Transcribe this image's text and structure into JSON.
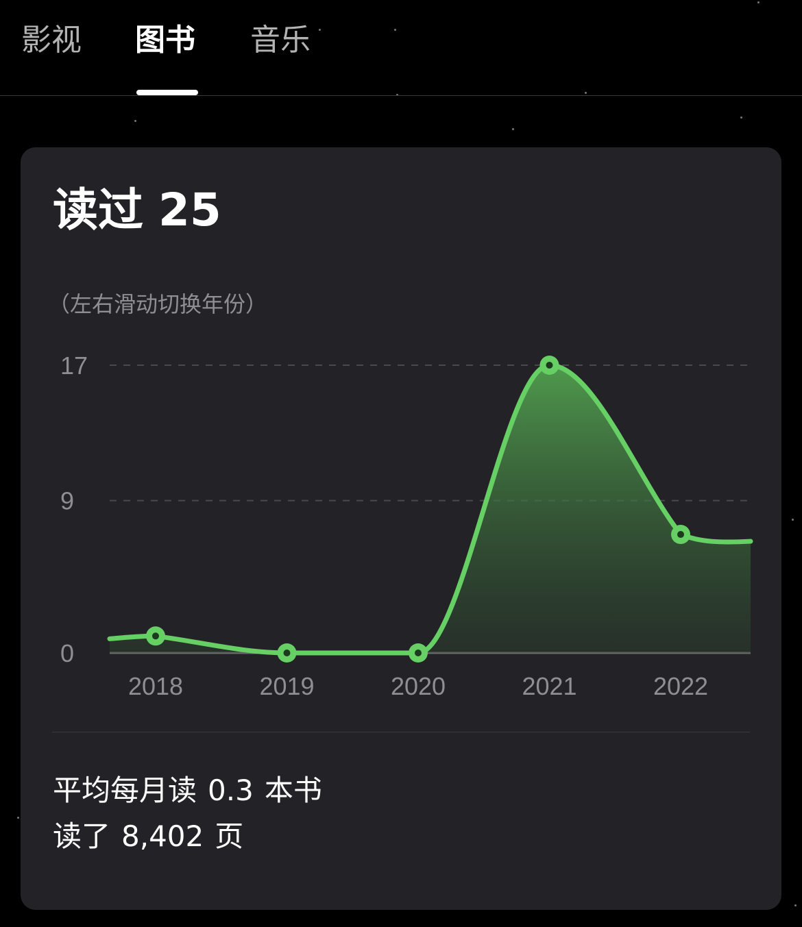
{
  "tabs": [
    {
      "label": "影视",
      "active": false
    },
    {
      "label": "图书",
      "active": true
    },
    {
      "label": "音乐",
      "active": false
    }
  ],
  "card": {
    "title_prefix": "读过",
    "title_count": "25",
    "hint": "（左右滑动切换年份）",
    "stat_avg_prefix": "平均每月读",
    "stat_avg_value": "0.3",
    "stat_avg_suffix": "本书",
    "stat_pages_prefix": "读了",
    "stat_pages_value": "8,402",
    "stat_pages_suffix": "页"
  },
  "colors": {
    "background": "#000000",
    "card": "#232327",
    "accent_green": "#66d064",
    "muted_text": "#8e8e93"
  },
  "chart_data": {
    "type": "area",
    "categories": [
      "2018",
      "2019",
      "2020",
      "2021",
      "2022"
    ],
    "values": [
      1,
      0,
      0,
      17,
      7
    ],
    "y_ticks": [
      "0",
      "9",
      "17"
    ],
    "ylim": [
      0,
      17
    ],
    "grid": true,
    "title": "",
    "xlabel": "",
    "ylabel": ""
  }
}
